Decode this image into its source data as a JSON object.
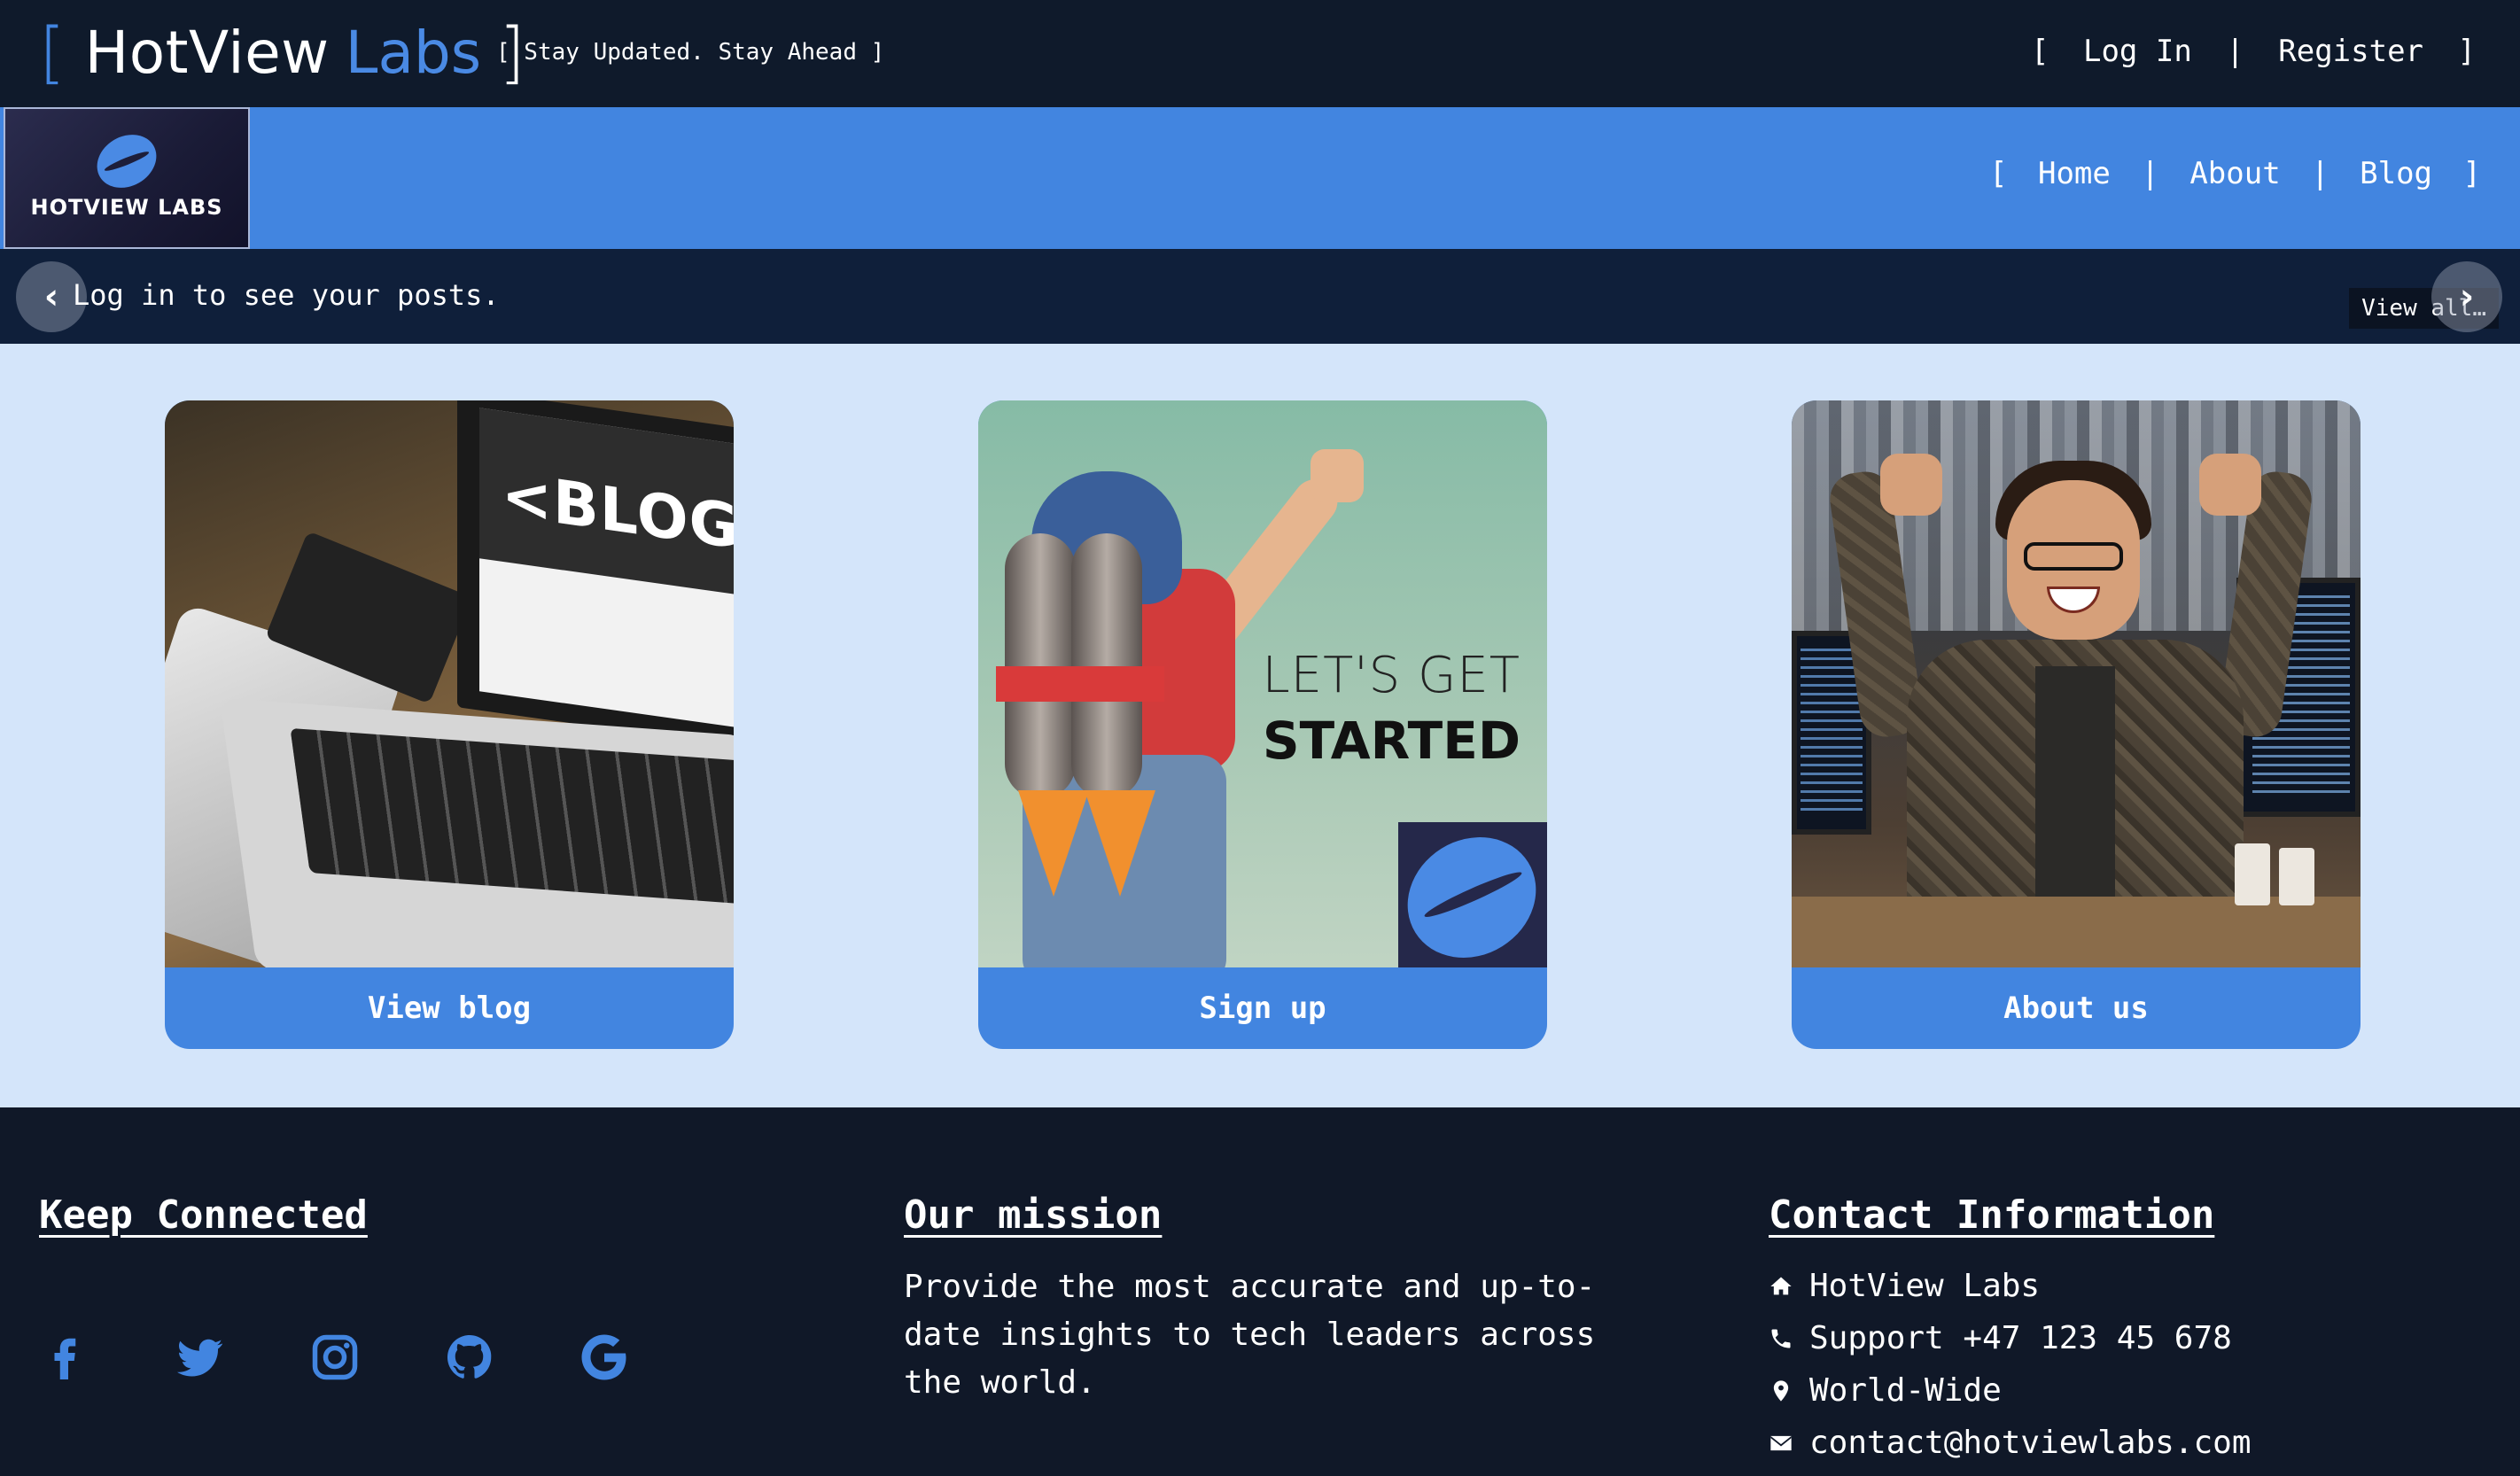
{
  "header": {
    "brand_open_bracket": "[",
    "brand_hot": "HotView",
    "brand_labs": "Labs",
    "brand_close_bracket": "]",
    "tagline": "[ Stay Updated. Stay Ahead ]",
    "auth_open": "[",
    "login_label": "Log In",
    "auth_sep": "|",
    "register_label": "Register",
    "auth_close": "]"
  },
  "navbar": {
    "logo_text": "HOTVIEW LABS",
    "open": "[",
    "items": [
      {
        "label": "Home"
      },
      {
        "label": "About"
      },
      {
        "label": "Blog"
      }
    ],
    "sep": "|",
    "close": "]"
  },
  "notice": {
    "text": "Log in to see your posts.",
    "prev_glyph": "‹",
    "next_glyph": "›",
    "view_all": "View all…"
  },
  "cards": [
    {
      "label": "View blog",
      "image_text": "<BLOG>"
    },
    {
      "label": "Sign up",
      "image_text_1": "LET'S GET",
      "image_text_2": "STARTED"
    },
    {
      "label": "About us"
    }
  ],
  "footer": {
    "keep_connected_title": "Keep Connected",
    "socials": [
      "facebook-icon",
      "twitter-icon",
      "instagram-icon",
      "github-icon",
      "google-icon"
    ],
    "mission_title": "Our mission",
    "mission_text": "Provide the most accurate and up-to-date insights to tech leaders across the world.",
    "contact_title": "Contact Information",
    "contact": {
      "company": "HotView Labs",
      "phone": "Support +47 123 45 678",
      "location": "World-Wide",
      "email": "contact@hotviewlabs.com"
    }
  },
  "colors": {
    "accent": "#4285e0",
    "dark_bg": "#101828",
    "notice_bg": "#0f1f3a",
    "cards_bg": "#d4e5fa"
  }
}
